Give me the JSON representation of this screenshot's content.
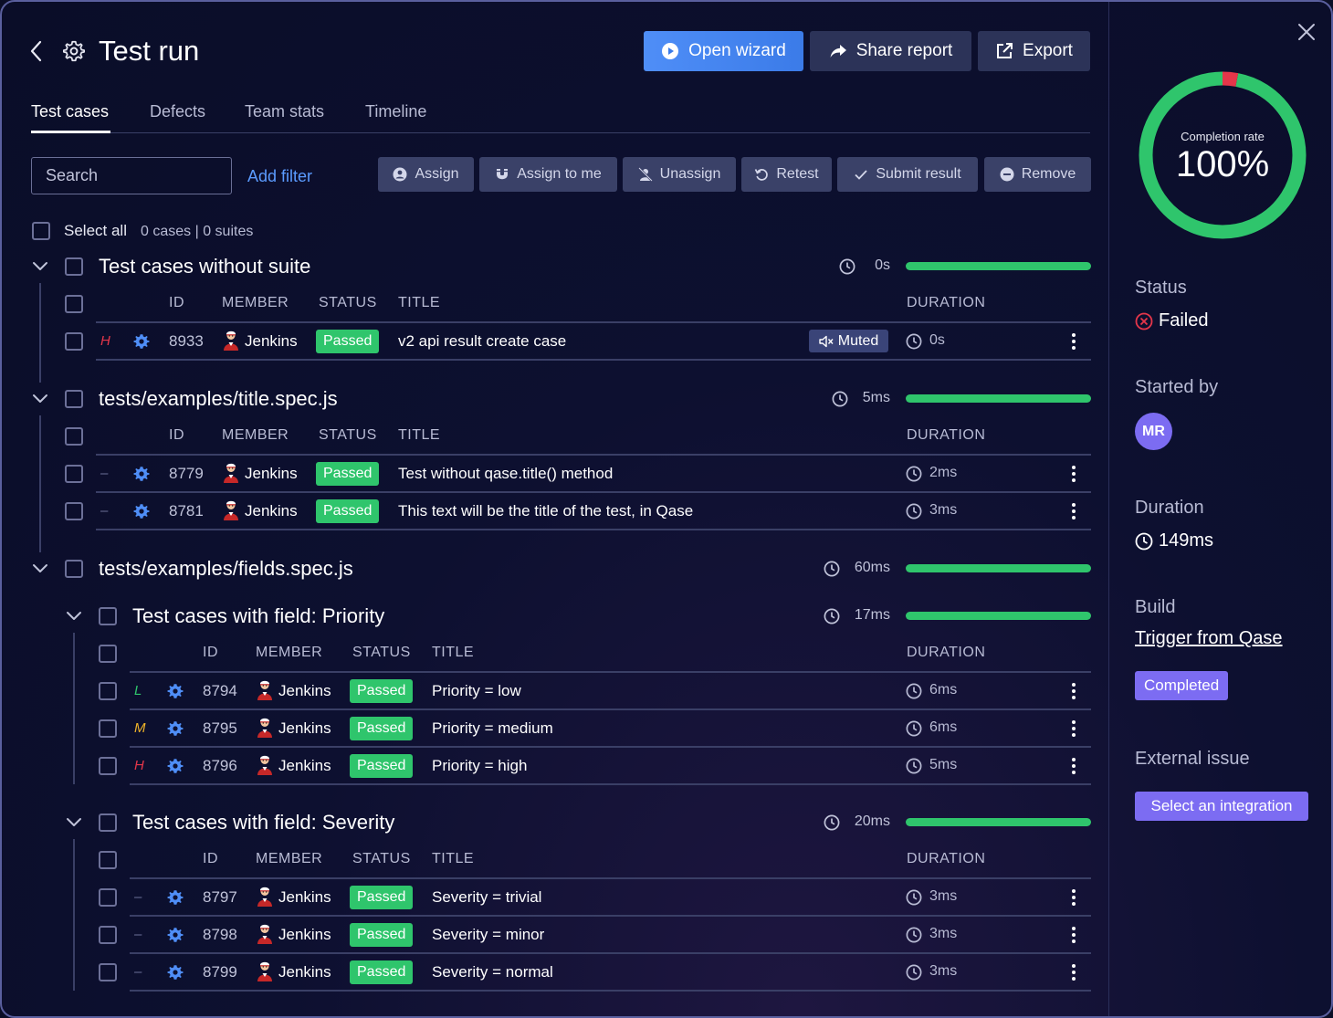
{
  "header": {
    "title": "Test run",
    "open_wizard": "Open wizard",
    "share_report": "Share report",
    "export": "Export"
  },
  "tabs": [
    "Test cases",
    "Defects",
    "Team stats",
    "Timeline"
  ],
  "toolbar": {
    "search_placeholder": "Search",
    "add_filter": "Add filter",
    "actions": [
      "Assign",
      "Assign to me",
      "Unassign",
      "Retest",
      "Submit result",
      "Remove"
    ]
  },
  "select_all": {
    "label": "Select all",
    "cases": "0 cases",
    "sep": "|",
    "suites": "0 suites"
  },
  "columns": {
    "id": "ID",
    "member": "MEMBER",
    "status": "STATUS",
    "title": "TITLE",
    "duration": "DURATION"
  },
  "suites": [
    {
      "title": "Test cases without suite",
      "time": "0s",
      "progress": 1.0,
      "cases": [
        {
          "prio": "H",
          "id": "8933",
          "member": "Jenkins",
          "status": "Passed",
          "title": "v2 api result create case",
          "muted": "Muted",
          "duration": "0s"
        }
      ]
    },
    {
      "title": "tests/examples/title.spec.js",
      "time": "5ms",
      "progress": 1.0,
      "cases": [
        {
          "prio": "–",
          "id": "8779",
          "member": "Jenkins",
          "status": "Passed",
          "title": "Test without qase.title() method",
          "duration": "2ms"
        },
        {
          "prio": "–",
          "id": "8781",
          "member": "Jenkins",
          "status": "Passed",
          "title": "This text will be the title of the test, in Qase",
          "duration": "3ms"
        }
      ]
    },
    {
      "title": "tests/examples/fields.spec.js",
      "time": "60ms",
      "progress": 1.0,
      "children": [
        {
          "title": "Test cases with field: Priority",
          "time": "17ms",
          "progress": 1.0,
          "cases": [
            {
              "prio": "L",
              "id": "8794",
              "member": "Jenkins",
              "status": "Passed",
              "title": "Priority = low",
              "duration": "6ms"
            },
            {
              "prio": "M",
              "id": "8795",
              "member": "Jenkins",
              "status": "Passed",
              "title": "Priority = medium",
              "duration": "6ms"
            },
            {
              "prio": "H",
              "id": "8796",
              "member": "Jenkins",
              "status": "Passed",
              "title": "Priority = high",
              "duration": "5ms"
            }
          ]
        },
        {
          "title": "Test cases with field: Severity",
          "time": "20ms",
          "progress": 1.0,
          "cases": [
            {
              "prio": "–",
              "id": "8797",
              "member": "Jenkins",
              "status": "Passed",
              "title": "Severity = trivial",
              "duration": "3ms"
            },
            {
              "prio": "–",
              "id": "8798",
              "member": "Jenkins",
              "status": "Passed",
              "title": "Severity = minor",
              "duration": "3ms"
            },
            {
              "prio": "–",
              "id": "8799",
              "member": "Jenkins",
              "status": "Passed",
              "title": "Severity = normal",
              "duration": "3ms"
            }
          ]
        }
      ]
    }
  ],
  "sidebar": {
    "completion_label": "Completion rate",
    "completion_value": "100%",
    "completion_passed_fraction": 0.97,
    "completion_failed_fraction": 0.03,
    "status_label": "Status",
    "status_value": "Failed",
    "started_by_label": "Started by",
    "started_by_initials": "MR",
    "duration_label": "Duration",
    "duration_value": "149ms",
    "build_label": "Build",
    "build_link": "Trigger from Qase",
    "build_status": "Completed",
    "external_issue_label": "External issue",
    "integration_button": "Select an integration"
  },
  "colors": {
    "passed": "#2fc56c",
    "failed": "#e5364a",
    "accent": "#4f8ef7",
    "purple": "#7c6cf2",
    "prio_high": "#e5364a",
    "prio_medium": "#f0b429",
    "prio_low": "#2fc56c",
    "prio_none": "#6c7098"
  },
  "icons": {
    "back": "chevron-left-icon",
    "settings": "gear-icon",
    "play": "play-circle-icon",
    "share": "share-arrow-icon",
    "export": "external-link-icon",
    "clock": "clock-icon",
    "automation": "gear-icon",
    "more": "kebab-icon",
    "close": "close-icon",
    "muted": "speaker-muted-icon"
  }
}
